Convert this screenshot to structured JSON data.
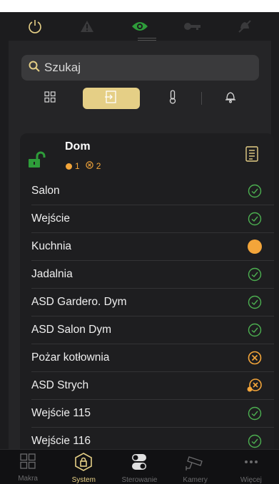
{
  "colors": {
    "accent": "#e5cf86",
    "ok": "#4caf50",
    "alarm": "#f3a53a",
    "lock": "#2e9d3a"
  },
  "header_icons": [
    "power-icon",
    "warning-icon",
    "eye-icon",
    "key-icon",
    "bell-off-icon"
  ],
  "search": {
    "placeholder": "Szukaj"
  },
  "segments": [
    "grid-icon",
    "door-enter-icon",
    "thermometer-icon",
    "bell-icon"
  ],
  "zone": {
    "title": "Dom",
    "count_alarm": "1",
    "count_fault": "2"
  },
  "rows": [
    {
      "name": "Salon",
      "status": "ok"
    },
    {
      "name": "Wejście",
      "status": "ok"
    },
    {
      "name": "Kuchnia",
      "status": "alarm-dot"
    },
    {
      "name": "Jadalnia",
      "status": "ok"
    },
    {
      "name": "ASD Gardero. Dym",
      "status": "ok"
    },
    {
      "name": "ASD Salon Dym",
      "status": "ok"
    },
    {
      "name": "Pożar kotłownia",
      "status": "fault"
    },
    {
      "name": "ASD Strych",
      "status": "fault-key"
    },
    {
      "name": "Wejście 115",
      "status": "ok"
    },
    {
      "name": "Wejście 116",
      "status": "ok"
    }
  ],
  "tabs": [
    {
      "label": "Makra"
    },
    {
      "label": "System"
    },
    {
      "label": "Sterowanie"
    },
    {
      "label": "Kamery"
    },
    {
      "label": "Więcej"
    }
  ]
}
